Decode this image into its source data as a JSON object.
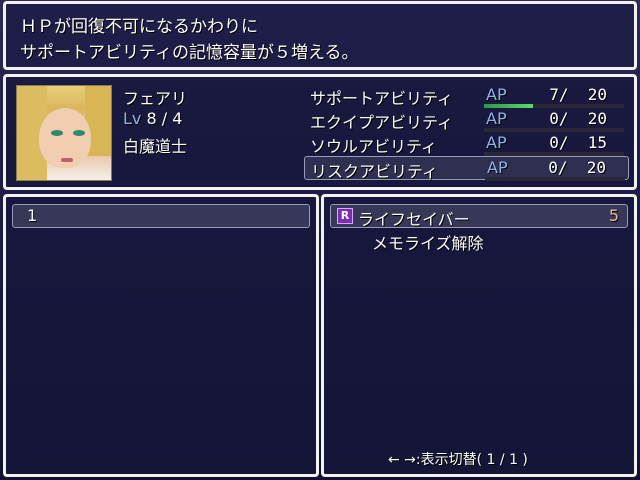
{
  "help": {
    "line1": "ＨＰが回復不可になるかわりに",
    "line2": "サポートアビリティの記憶容量が５増える。"
  },
  "character": {
    "name": "フェアリ",
    "level_label": "Lv",
    "level_value": "8 / 4",
    "job": "白魔道士"
  },
  "abilities": [
    {
      "name": "サポートアビリティ",
      "ap_label": "AP",
      "current": 7,
      "max": 20,
      "display": " 7/  20",
      "fill": 0.35
    },
    {
      "name": "エクイプアビリティ",
      "ap_label": "AP",
      "current": 0,
      "max": 20,
      "display": " 0/  20",
      "fill": 0
    },
    {
      "name": "ソウルアビリティ",
      "ap_label": "AP",
      "current": 0,
      "max": 15,
      "display": " 0/  15",
      "fill": 0
    },
    {
      "name": "リスクアビリティ",
      "ap_label": "AP",
      "current": 0,
      "max": 20,
      "display": " 0/  20",
      "fill": 0
    }
  ],
  "left_list": {
    "selected_item": "1"
  },
  "right_list": {
    "skill_icon": "R",
    "skill_name": "ライフセイバー",
    "skill_cost": "5",
    "sub_item": "メモライズ解除",
    "footer": "← →:表示切替( 1 / 1 )"
  }
}
